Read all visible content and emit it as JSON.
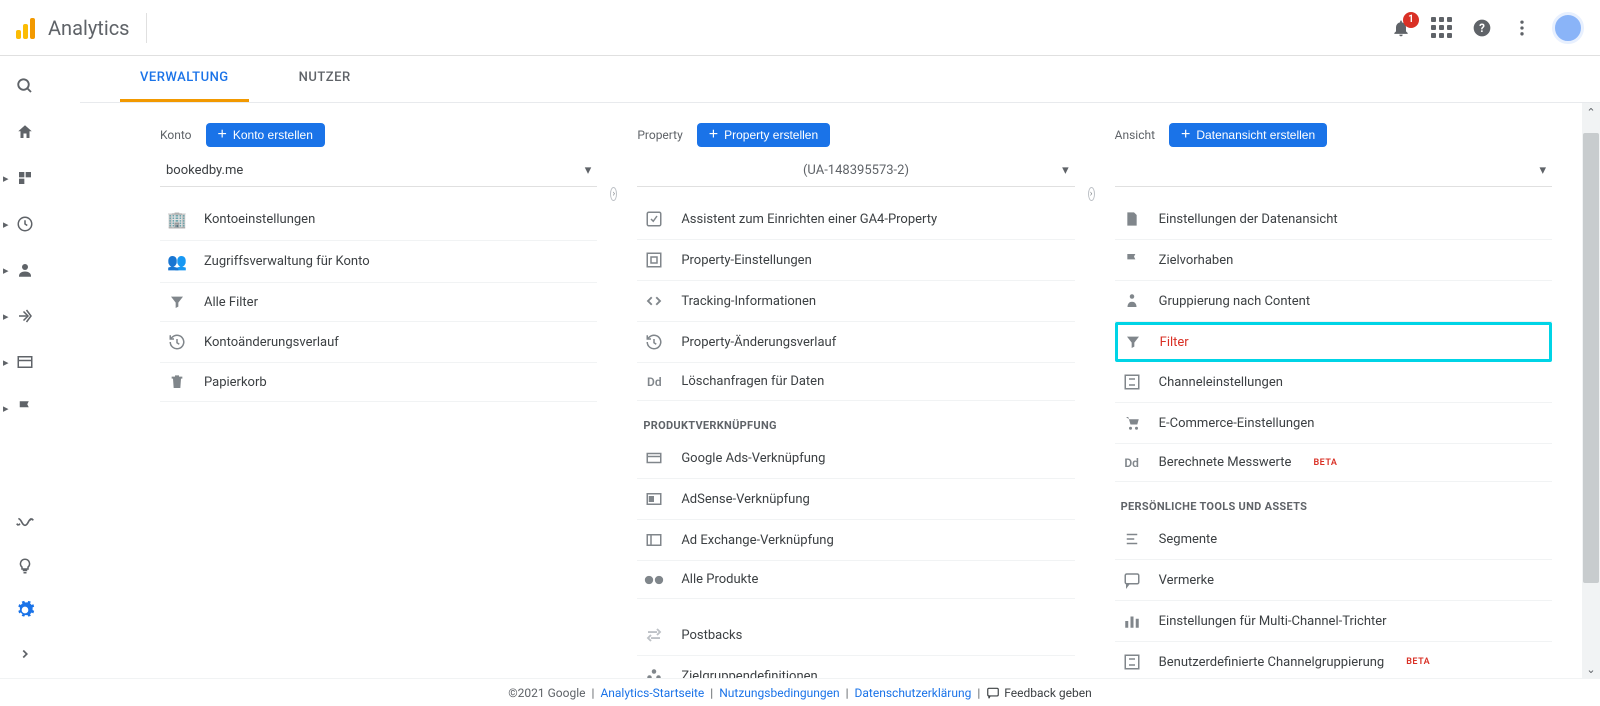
{
  "app_title": "Analytics",
  "notification_count": "1",
  "tabs": {
    "admin": "VERWALTUNG",
    "users": "NUTZER"
  },
  "columns": {
    "account": {
      "label": "Konto",
      "button": "Konto erstellen",
      "selector": "bookedby.me",
      "items": [
        {
          "label": "Kontoeinstellungen"
        },
        {
          "label": "Zugriffsverwaltung für Konto"
        },
        {
          "label": "Alle Filter"
        },
        {
          "label": "Kontoänderungsverlauf"
        },
        {
          "label": "Papierkorb"
        }
      ]
    },
    "property": {
      "label": "Property",
      "button": "Property erstellen",
      "selector": "(UA-148395573-2)",
      "items": [
        {
          "label": "Assistent zum Einrichten einer GA4-Property"
        },
        {
          "label": "Property-Einstellungen"
        },
        {
          "label": "Tracking-Informationen"
        },
        {
          "label": "Property-Änderungsverlauf"
        },
        {
          "label": "Löschanfragen für Daten"
        }
      ],
      "section_link": "PRODUKTVERKNÜPFUNG",
      "link_items": [
        {
          "label": "Google Ads-Verknüpfung"
        },
        {
          "label": "AdSense-Verknüpfung"
        },
        {
          "label": "Ad Exchange-Verknüpfung"
        },
        {
          "label": "Alle Produkte"
        }
      ],
      "extra_items": [
        {
          "label": "Postbacks"
        },
        {
          "label": "Zielgruppendefinitionen"
        }
      ]
    },
    "view": {
      "label": "Ansicht",
      "button": "Datenansicht erstellen",
      "selector": "",
      "items": [
        {
          "label": "Einstellungen der Datenansicht"
        },
        {
          "label": "Zielvorhaben"
        },
        {
          "label": "Gruppierung nach Content"
        },
        {
          "label": "Filter",
          "highlight": true
        },
        {
          "label": "Channeleinstellungen"
        },
        {
          "label": "E-Commerce-Einstellungen"
        },
        {
          "label": "Berechnete Messwerte",
          "beta": "BETA"
        }
      ],
      "section_personal": "PERSÖNLICHE TOOLS UND ASSETS",
      "personal_items": [
        {
          "label": "Segmente"
        },
        {
          "label": "Vermerke"
        },
        {
          "label": "Einstellungen für Multi-Channel-Trichter"
        },
        {
          "label": "Benutzerdefinierte Channelgruppierung",
          "beta": "BETA"
        }
      ]
    }
  },
  "footer": {
    "copyright": "©2021 Google",
    "links": [
      "Analytics-Startseite",
      "Nutzungsbedingungen",
      "Datenschutzerklärung"
    ],
    "feedback": "Feedback geben"
  }
}
